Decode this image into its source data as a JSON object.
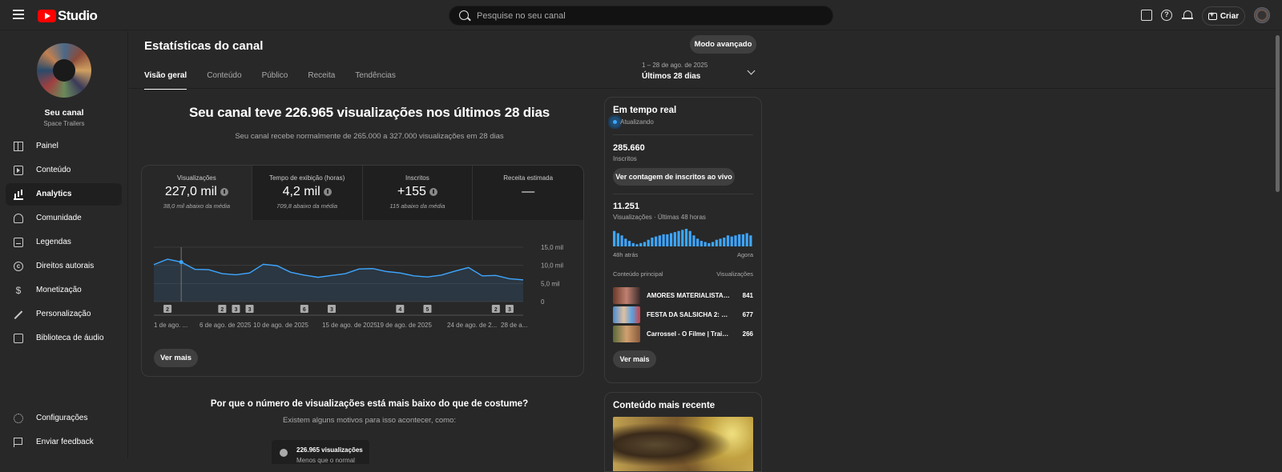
{
  "topbar": {
    "logo_text": "Studio",
    "search_placeholder": "Pesquise no seu canal",
    "create_label": "Criar"
  },
  "sidebar": {
    "channel_name": "Seu canal",
    "channel_sub": "Space Trailers",
    "items": [
      {
        "label": "Painel",
        "icon": "dashboard-icon"
      },
      {
        "label": "Conteúdo",
        "icon": "content-icon"
      },
      {
        "label": "Analytics",
        "icon": "analytics-icon",
        "active": true
      },
      {
        "label": "Comunidade",
        "icon": "community-icon"
      },
      {
        "label": "Legendas",
        "icon": "subtitles-icon"
      },
      {
        "label": "Direitos autorais",
        "icon": "copyright-icon"
      },
      {
        "label": "Monetização",
        "icon": "monetization-icon"
      },
      {
        "label": "Personalização",
        "icon": "customization-icon"
      },
      {
        "label": "Biblioteca de áudio",
        "icon": "audio-library-icon"
      }
    ],
    "bottom_items": [
      {
        "label": "Configurações",
        "icon": "gear-icon"
      },
      {
        "label": "Enviar feedback",
        "icon": "feedback-icon"
      }
    ]
  },
  "header": {
    "title": "Estatísticas do canal",
    "advanced_mode": "Modo avançado",
    "tabs": [
      "Visão geral",
      "Conteúdo",
      "Público",
      "Receita",
      "Tendências"
    ],
    "date_range_small": "1 – 28 de ago. de 2025",
    "date_range_big": "Últimos 28 dias"
  },
  "overview": {
    "headline": "Seu canal teve 226.965 visualizações nos últimos 28 dias",
    "subline": "Seu canal recebe normalmente de 265.000 a 327.000 visualizações em 28 dias",
    "metrics": [
      {
        "label": "Visualizações",
        "value": "227,0 mil",
        "note": "38,0 mil abaixo da média"
      },
      {
        "label": "Tempo de exibição (horas)",
        "value": "4,2 mil",
        "note": "709,8 abaixo da média"
      },
      {
        "label": "Inscritos",
        "value": "+155",
        "note": "115 abaixo da média"
      },
      {
        "label": "Receita estimada",
        "value": "—",
        "note": ""
      }
    ],
    "see_more": "Ver mais"
  },
  "chart_data": {
    "type": "area",
    "y_ticks": [
      "15,0 mil",
      "10,0 mil",
      "5,0 mil",
      "0"
    ],
    "ylim": [
      0,
      15000
    ],
    "x_labels": [
      "1 de ago. ...",
      "6 de ago. de 2025",
      "10 de ago. de 2025",
      "15 de ago. de 2025",
      "19 de ago. de 2025",
      "24 de ago. de 2...",
      "28 de a..."
    ],
    "series": [
      {
        "values": [
          10200,
          11700,
          10900,
          8900,
          8800,
          7700,
          7400,
          7900,
          10300,
          9900,
          8100,
          7300,
          6700,
          7200,
          7700,
          9000,
          9100,
          8300,
          7900,
          7100,
          6800,
          7300,
          8400,
          9400,
          7100,
          7200,
          6300,
          6000
        ]
      }
    ],
    "markers": [
      {
        "day": 2,
        "label": "2"
      },
      {
        "day": 6,
        "label": "2"
      },
      {
        "day": 7,
        "label": "3"
      },
      {
        "day": 8,
        "label": "3"
      },
      {
        "day": 12,
        "label": "6"
      },
      {
        "day": 14,
        "label": "3"
      },
      {
        "day": 19,
        "label": "4"
      },
      {
        "day": 21,
        "label": "5"
      },
      {
        "day": 26,
        "label": "2"
      },
      {
        "day": 27,
        "label": "3"
      }
    ]
  },
  "why": {
    "title": "Por que o número de visualizações está mais baixo do que de costume?",
    "subtitle": "Existem alguns motivos para isso acontecer, como:",
    "card_value": "226.965 visualizações",
    "card_note": "Menos que o normal"
  },
  "realtime": {
    "title": "Em tempo real",
    "updating": "Atualizando",
    "subscribers": "285.660",
    "subscribers_label": "Inscritos",
    "live_button": "Ver contagem de inscritos ao vivo",
    "views": "11.251",
    "views_label": "Visualizações · Últimas 48 horas",
    "bars": [
      14,
      12,
      10,
      7,
      5,
      3,
      2,
      3,
      4,
      6,
      8,
      9,
      10,
      11,
      11,
      12,
      13,
      14,
      15,
      16,
      14,
      10,
      7,
      5,
      4,
      3,
      4,
      6,
      7,
      8,
      10,
      9,
      10,
      11,
      11,
      12,
      10
    ],
    "ago_label": "48h atrás",
    "now_label": "Agora",
    "top_label": "Conteúdo principal",
    "top_views_label": "Visualizações",
    "top_items": [
      {
        "title": "AMORES MATERIALISTAS ...",
        "views": "841"
      },
      {
        "title": "FESTA DA SALSICHA 2: CO...",
        "views": "677"
      },
      {
        "title": "Carrossel - O Filme | Trailer...",
        "views": "266"
      }
    ],
    "see_more": "Ver mais"
  },
  "recent": {
    "title": "Conteúdo mais recente"
  }
}
